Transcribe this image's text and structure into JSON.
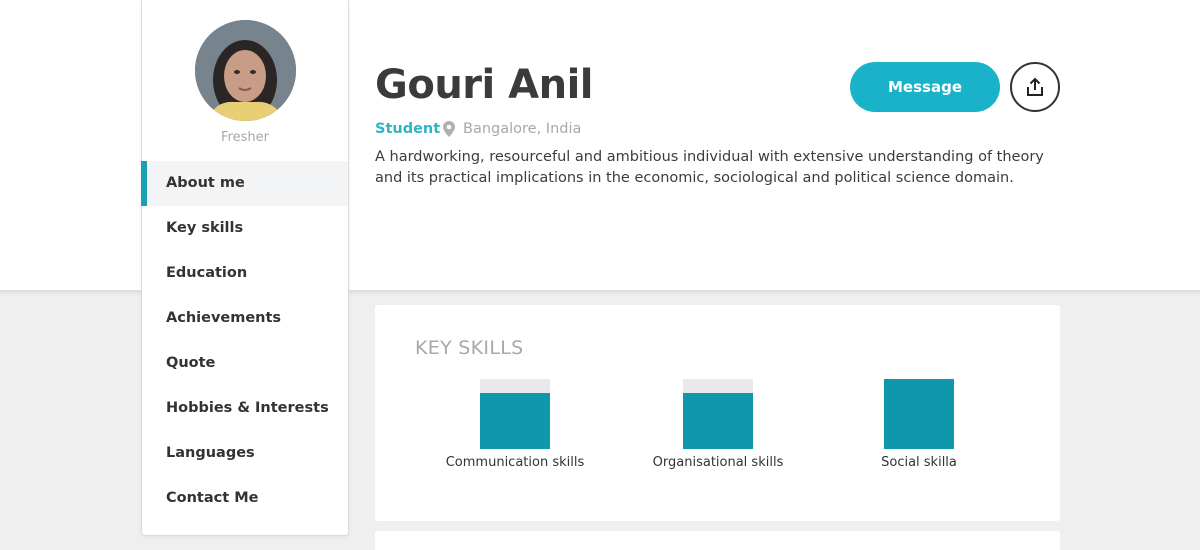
{
  "profile": {
    "name": "Gouri Anil",
    "role": "Student",
    "location": "Bangalore, India",
    "level": "Fresher",
    "bio": "A hardworking, resourceful and ambitious individual with extensive understanding of theory and its practical implications in the economic, sociological and political science domain."
  },
  "actions": {
    "message_label": "Message",
    "share_icon": "share-icon"
  },
  "sidebar": {
    "items": [
      {
        "label": "About me",
        "active": true
      },
      {
        "label": "Key skills",
        "active": false
      },
      {
        "label": "Education",
        "active": false
      },
      {
        "label": "Achievements",
        "active": false
      },
      {
        "label": "Quote",
        "active": false
      },
      {
        "label": "Hobbies & Interests",
        "active": false
      },
      {
        "label": "Languages",
        "active": false
      },
      {
        "label": "Contact Me",
        "active": false
      }
    ]
  },
  "key_skills": {
    "title": "KEY SKILLS",
    "skills": [
      {
        "name": "Communication skills",
        "level": 0.8
      },
      {
        "name": "Organisational skills",
        "level": 0.8
      },
      {
        "name": "Social skilla",
        "level": 1.0
      }
    ]
  },
  "colors": {
    "accent": "#1ab2c9",
    "bar": "#0f98ab",
    "role": "#31b3c3"
  }
}
